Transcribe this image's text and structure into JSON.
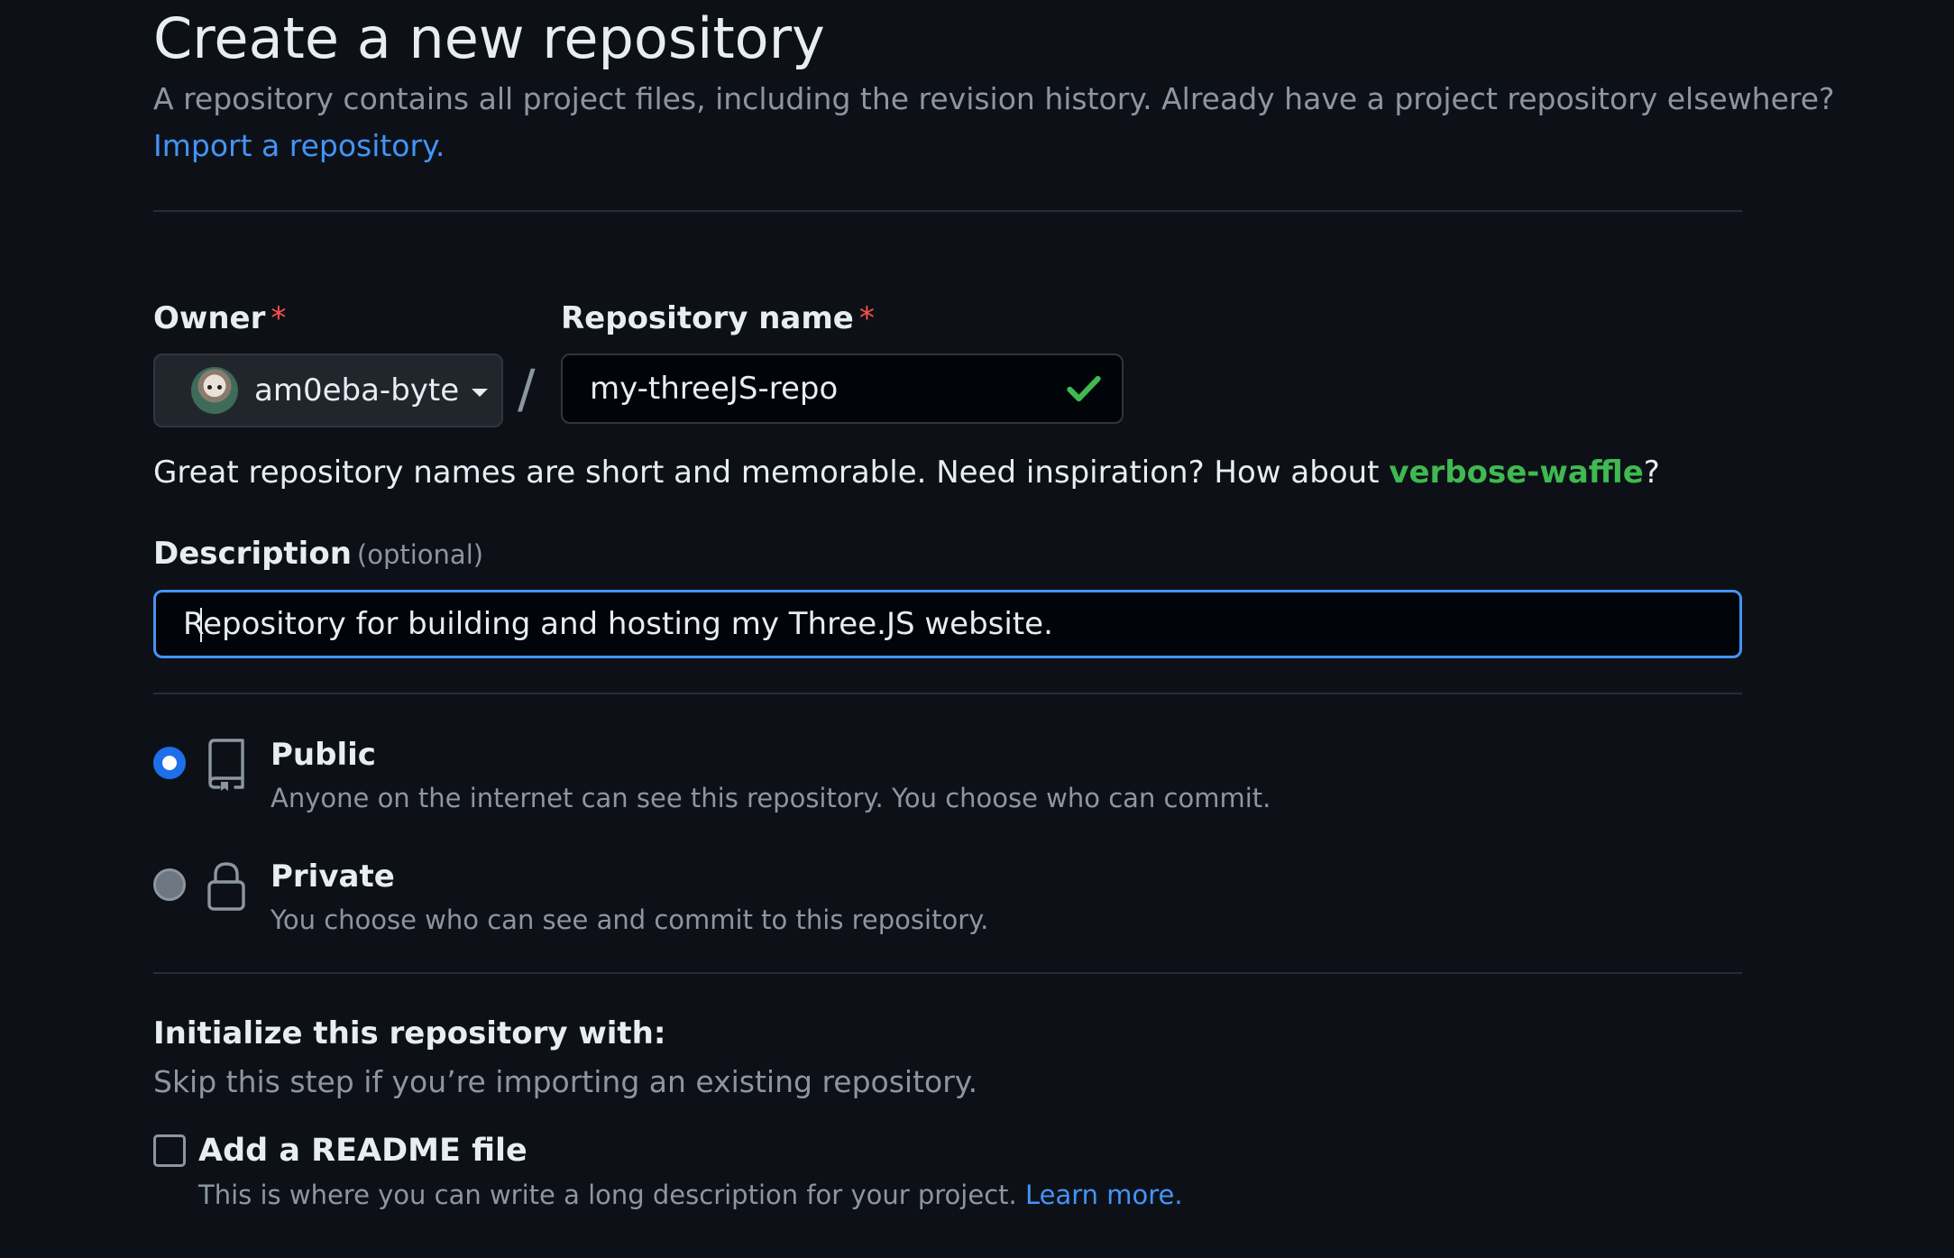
{
  "header": {
    "title": "Create a new repository",
    "subtitle": "A repository contains all project files, including the revision history. Already have a project repository elsewhere?",
    "import_link": "Import a repository."
  },
  "owner": {
    "label": "Owner",
    "required_mark": "*",
    "value": "am0eba-byte"
  },
  "separator": "/",
  "repository_name": {
    "label": "Repository name",
    "required_mark": "*",
    "value": "my-threeJS-repo",
    "valid": true
  },
  "name_hint": {
    "prefix": "Great repository names are short and memorable. Need inspiration? How about ",
    "suggestion": "verbose-waffle",
    "suffix": "?"
  },
  "description": {
    "label": "Description",
    "optional": "(optional)",
    "value": "Repository for building and hosting my Three.JS website."
  },
  "visibility": {
    "selected": "public",
    "options": [
      {
        "id": "public",
        "label": "Public",
        "description": "Anyone on the internet can see this repository. You choose who can commit.",
        "icon": "repo-icon"
      },
      {
        "id": "private",
        "label": "Private",
        "description": "You choose who can see and commit to this repository.",
        "icon": "lock-icon"
      }
    ]
  },
  "initialize": {
    "title": "Initialize this repository with:",
    "subtitle": "Skip this step if you’re importing an existing repository.",
    "readme": {
      "label": "Add a README file",
      "description": "This is where you can write a long description for your project. ",
      "learn_more": "Learn more.",
      "checked": false
    }
  },
  "colors": {
    "background": "#0d1117",
    "link": "#4493f8",
    "success": "#3fb950",
    "required": "#f85149",
    "focus_border": "#4493f8",
    "radio_selected": "#1f6feb"
  }
}
